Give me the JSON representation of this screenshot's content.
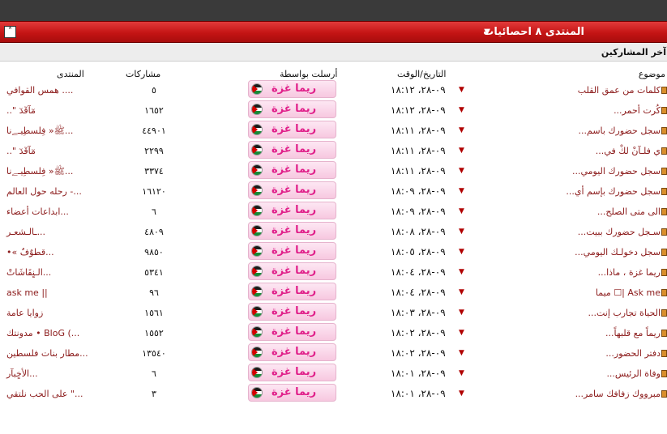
{
  "header": {
    "title": "المنتدى ٨ احصائيات",
    "arrow_icon": "triangle-down-icon",
    "collapse_icon": "chevron-up-icon"
  },
  "subheader": {
    "title": "آخر المشاركين"
  },
  "columns": {
    "topic": "موضوع",
    "date": "التاريخ/الوقت",
    "poster": "أرسلت بواسطة",
    "posts": "مشاركات",
    "forum": "المنتدى"
  },
  "colors": {
    "accent": "#c41414",
    "link": "#8b1a1a",
    "poster_name": "#e0208a"
  },
  "rows": [
    {
      "topic": "كلمات من عمق القلب",
      "date": "٠٩-٢٨، ١٨:١٢",
      "poster": "ريما غزة",
      "posts": "٥",
      "forum": "همس القوافي ...."
    },
    {
      "topic": "كُرت أحمر...",
      "date": "٠٩-٢٨، ١٨:١٢",
      "poster": "ريما غزة",
      "posts": "١٦٥٢",
      "forum": "..\" مٓآقٓدٓ"
    },
    {
      "topic": "سجل حضورك باسم...",
      "date": "٠٩-٢٨، ١٨:١١",
      "poster": "ريما غزة",
      "posts": "٤٤٩٠١",
      "forum": "ﷺ« فِلسطِيـﮯنا..."
    },
    {
      "topic": "ي فلـآنْ لكْ في...",
      "date": "٠٩-٢٨، ١٨:١١",
      "poster": "ريما غزة",
      "posts": "٢٢٩٩",
      "forum": "..\" مٓآقٓدٓ"
    },
    {
      "topic": "سجل حضورك اليومي...",
      "date": "٠٩-٢٨، ١٨:١١",
      "poster": "ريما غزة",
      "posts": "٣٣٧٤",
      "forum": "ﷺ« فِلسطِيـﮯنا..."
    },
    {
      "topic": "سجل حضورك بإسم أي...",
      "date": "٠٩-٢٨، ١٨:٠٩",
      "poster": "ريما غزة",
      "posts": "١٦١٢٠",
      "forum": "رحله حول العالم -..."
    },
    {
      "topic": "الى متى الصلح...",
      "date": "٠٩-٢٨، ١٨:٠٩",
      "poster": "ريما غزة",
      "posts": "٦",
      "forum": "ابداعات أعضاء..."
    },
    {
      "topic": "سـجل حضورك ببيت...",
      "date": "٠٩-٢٨، ١٨:٠٨",
      "poster": "ريما غزة",
      "posts": "٤٨٠٩",
      "forum": "ـالـشعـر..."
    },
    {
      "topic": "سجل دخولـك اليومي...",
      "date": "٠٩-٢٨، ١٨:٠٥",
      "poster": "ريما غزة",
      "posts": "٩٨٥٠",
      "forum": "•« قطوٌفٌ..."
    },
    {
      "topic": "ريما غزة ، ماذا...",
      "date": "٠٩-٢٨، ١٨:٠٤",
      "poster": "ريما غزة",
      "posts": "٥٣٤١",
      "forum": "الـنٍقَاشَاتْ..."
    },
    {
      "topic": "Ask me |☐ ميما",
      "date": "٠٩-٢٨، ١٨:٠٤",
      "poster": "ريما غزة",
      "posts": "٩٦",
      "forum": "ask me ||"
    },
    {
      "topic": "الحياة تجارب إنت...",
      "date": "٠٩-٢٨، ١٨:٠٣",
      "poster": "ريما غزة",
      "posts": "١٥٦١",
      "forum": "زوايا عامة"
    },
    {
      "topic": "ريماً مع قلبهاً...",
      "date": "٠٩-٢٨، ١٨:٠٢",
      "poster": "ريما غزة",
      "posts": "١٥٥٢",
      "forum": "مدونتك • BloG (..."
    },
    {
      "topic": "دفتر الحضور...",
      "date": "٠٩-٢٨، ١٨:٠٢",
      "poster": "ريما غزة",
      "posts": "١٣٥٤٠",
      "forum": "مطار بنات فلسطين..."
    },
    {
      "topic": "وفاة الرئيس...",
      "date": "٠٩-٢٨، ١٨:٠١",
      "poster": "ريما غزة",
      "posts": "٦",
      "forum": "الأخٍبآر..."
    },
    {
      "topic": "مبرووك زفافك سامر...",
      "date": "٠٩-٢٨، ١٨:٠١",
      "poster": "ريما غزة",
      "posts": "٣",
      "forum": "على الحب نلتقي \"..."
    }
  ]
}
